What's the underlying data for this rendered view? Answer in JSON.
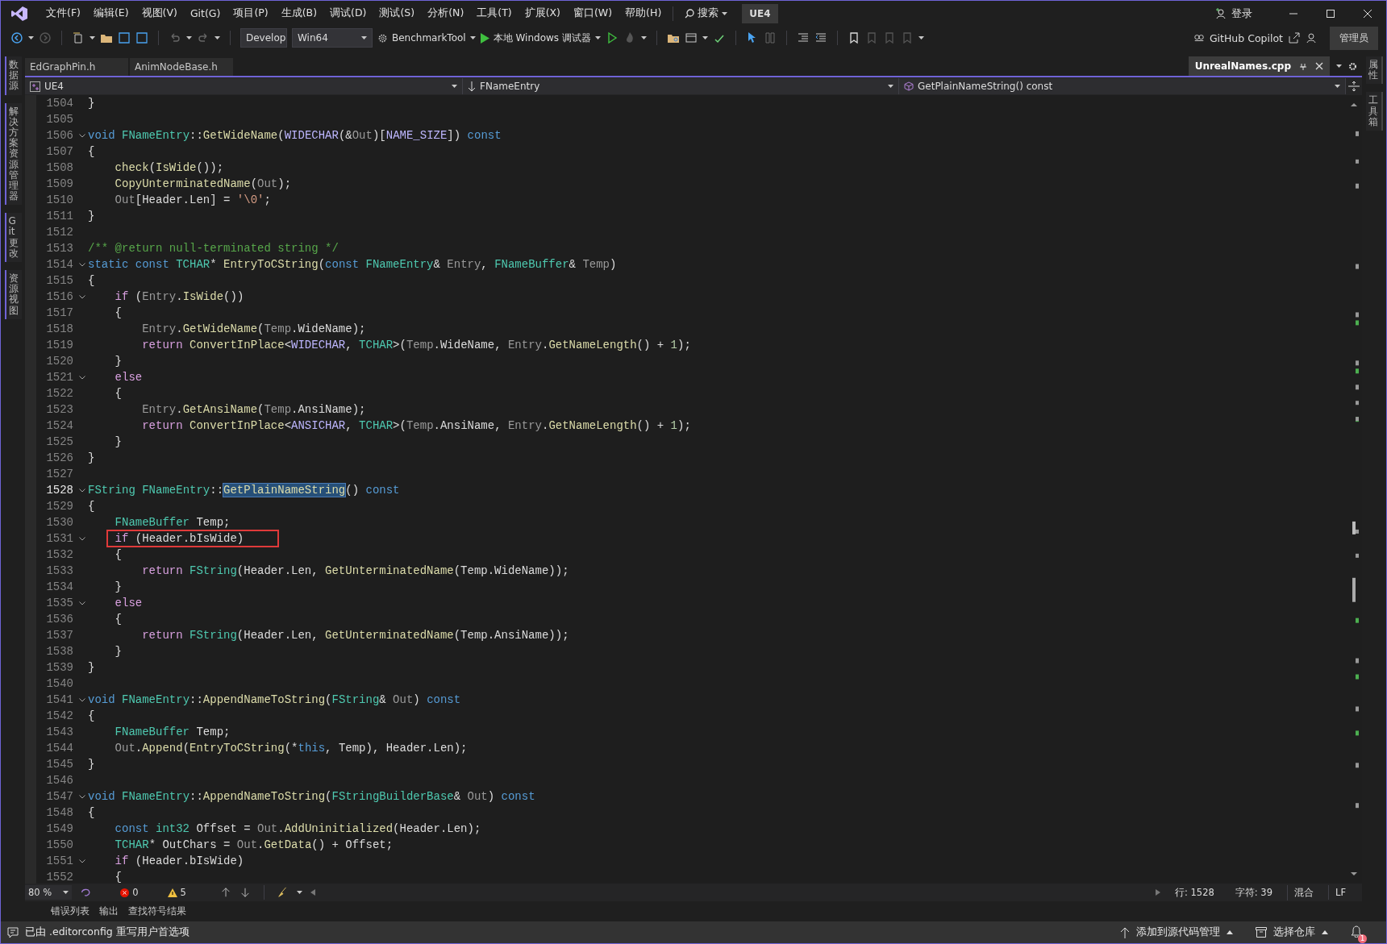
{
  "menu": [
    "文件(F)",
    "编辑(E)",
    "视图(V)",
    "Git(G)",
    "项目(P)",
    "生成(B)",
    "调试(D)",
    "测试(S)",
    "分析(N)",
    "工具(T)",
    "扩展(X)",
    "窗口(W)",
    "帮助(H)"
  ],
  "search": "搜索",
  "solution": "UE4",
  "login": "登录",
  "toolbar": {
    "configuration": "Develop",
    "platform": "Win64",
    "startup": "BenchmarkTool",
    "debugger": "本地 Windows 调试器",
    "copilot": "GitHub Copilot",
    "admin": "管理员"
  },
  "left_tabs": [
    "数据源",
    "解决方案资源管理器",
    "Git 更改",
    "资源视图"
  ],
  "right_tabs": [
    "属性",
    "工具箱"
  ],
  "doc_tabs": [
    {
      "label": "EdGraphPin.h",
      "selected": false
    },
    {
      "label": "AnimNodeBase.h",
      "selected": false
    },
    {
      "label": "UnrealNames.cpp",
      "selected": true
    }
  ],
  "nav": {
    "project": "UE4",
    "scope": "FNameEntry",
    "member": "GetPlainNameString() const"
  },
  "lines": [
    {
      "number": "1504",
      "fold": false,
      "current": false,
      "boxed": false,
      "tokens": [
        {
          "kind": "plain",
          "text": "}"
        }
      ]
    },
    {
      "number": "1505",
      "fold": false,
      "current": false,
      "boxed": false
    },
    {
      "number": "1506",
      "fold": true,
      "current": false,
      "boxed": false,
      "tokens": [
        {
          "kind": "keyword",
          "text": "void "
        },
        {
          "kind": "type",
          "text": "FNameEntry"
        },
        {
          "kind": "plain",
          "text": "::"
        },
        {
          "kind": "function",
          "text": "GetWideName"
        },
        {
          "kind": "plain",
          "text": "("
        },
        {
          "kind": "macro",
          "text": "WIDECHAR"
        },
        {
          "kind": "plain",
          "text": "(&"
        },
        {
          "kind": "param",
          "text": "Out"
        },
        {
          "kind": "plain",
          "text": ")["
        },
        {
          "kind": "macro",
          "text": "NAME_SIZE"
        },
        {
          "kind": "plain",
          "text": "]) "
        },
        {
          "kind": "keyword",
          "text": "const"
        }
      ]
    },
    {
      "number": "1507",
      "fold": false,
      "current": false,
      "boxed": false,
      "tokens": [
        {
          "kind": "plain",
          "text": "{"
        }
      ]
    },
    {
      "number": "1508",
      "fold": false,
      "current": false,
      "boxed": false,
      "tokens": [
        {
          "kind": "function",
          "text": "    check"
        },
        {
          "kind": "plain",
          "text": "("
        },
        {
          "kind": "function",
          "text": "IsWide"
        },
        {
          "kind": "plain",
          "text": "());"
        }
      ]
    },
    {
      "number": "1509",
      "fold": false,
      "current": false,
      "boxed": false,
      "tokens": [
        {
          "kind": "function",
          "text": "    CopyUnterminatedName"
        },
        {
          "kind": "plain",
          "text": "("
        },
        {
          "kind": "param",
          "text": "Out"
        },
        {
          "kind": "plain",
          "text": ");"
        }
      ]
    },
    {
      "number": "1510",
      "fold": false,
      "current": false,
      "boxed": false,
      "tokens": [
        {
          "kind": "param",
          "text": "    Out"
        },
        {
          "kind": "plain",
          "text": "[Header.Len] = "
        },
        {
          "kind": "string",
          "text": "'\\0'"
        },
        {
          "kind": "plain",
          "text": ";"
        }
      ]
    },
    {
      "number": "1511",
      "fold": false,
      "current": false,
      "boxed": false,
      "tokens": [
        {
          "kind": "plain",
          "text": "}"
        }
      ]
    },
    {
      "number": "1512",
      "fold": false,
      "current": false,
      "boxed": false
    },
    {
      "number": "1513",
      "fold": false,
      "current": false,
      "boxed": false,
      "tokens": [
        {
          "kind": "comment",
          "text": "/** @return null-terminated string */"
        }
      ]
    },
    {
      "number": "1514",
      "fold": true,
      "current": false,
      "boxed": false,
      "tokens": [
        {
          "kind": "keyword",
          "text": "static const "
        },
        {
          "kind": "type",
          "text": "TCHAR"
        },
        {
          "kind": "plain",
          "text": "* "
        },
        {
          "kind": "function",
          "text": "EntryToCString"
        },
        {
          "kind": "plain",
          "text": "("
        },
        {
          "kind": "keyword",
          "text": "const "
        },
        {
          "kind": "type",
          "text": "FNameEntry"
        },
        {
          "kind": "plain",
          "text": "& "
        },
        {
          "kind": "param",
          "text": "Entry"
        },
        {
          "kind": "plain",
          "text": ", "
        },
        {
          "kind": "type",
          "text": "FNameBuffer"
        },
        {
          "kind": "plain",
          "text": "& "
        },
        {
          "kind": "param",
          "text": "Temp"
        },
        {
          "kind": "plain",
          "text": ")"
        }
      ]
    },
    {
      "number": "1515",
      "fold": false,
      "current": false,
      "boxed": false,
      "tokens": [
        {
          "kind": "plain",
          "text": "{"
        }
      ]
    },
    {
      "number": "1516",
      "fold": true,
      "current": false,
      "boxed": false,
      "tokens": [
        {
          "kind": "control",
          "text": "    if"
        },
        {
          "kind": "plain",
          "text": " ("
        },
        {
          "kind": "param",
          "text": "Entry"
        },
        {
          "kind": "plain",
          "text": "."
        },
        {
          "kind": "function",
          "text": "IsWide"
        },
        {
          "kind": "plain",
          "text": "())"
        }
      ]
    },
    {
      "number": "1517",
      "fold": false,
      "current": false,
      "boxed": false,
      "tokens": [
        {
          "kind": "plain",
          "text": "    {"
        }
      ]
    },
    {
      "number": "1518",
      "fold": false,
      "current": false,
      "boxed": false,
      "tokens": [
        {
          "kind": "param",
          "text": "        Entry"
        },
        {
          "kind": "plain",
          "text": "."
        },
        {
          "kind": "function",
          "text": "GetWideName"
        },
        {
          "kind": "plain",
          "text": "("
        },
        {
          "kind": "param",
          "text": "Temp"
        },
        {
          "kind": "plain",
          "text": ".WideName);"
        }
      ]
    },
    {
      "number": "1519",
      "fold": false,
      "current": false,
      "boxed": false,
      "tokens": [
        {
          "kind": "control",
          "text": "        return "
        },
        {
          "kind": "function",
          "text": "ConvertInPlace"
        },
        {
          "kind": "plain",
          "text": "<"
        },
        {
          "kind": "macro",
          "text": "WIDECHAR"
        },
        {
          "kind": "plain",
          "text": ", "
        },
        {
          "kind": "type",
          "text": "TCHAR"
        },
        {
          "kind": "plain",
          "text": ">("
        },
        {
          "kind": "param",
          "text": "Temp"
        },
        {
          "kind": "plain",
          "text": ".WideName, "
        },
        {
          "kind": "param",
          "text": "Entry"
        },
        {
          "kind": "plain",
          "text": "."
        },
        {
          "kind": "function",
          "text": "GetNameLength"
        },
        {
          "kind": "plain",
          "text": "() + "
        },
        {
          "kind": "number",
          "text": "1"
        },
        {
          "kind": "plain",
          "text": ");"
        }
      ]
    },
    {
      "number": "1520",
      "fold": false,
      "current": false,
      "boxed": false,
      "tokens": [
        {
          "kind": "plain",
          "text": "    }"
        }
      ]
    },
    {
      "number": "1521",
      "fold": true,
      "current": false,
      "boxed": false,
      "tokens": [
        {
          "kind": "control",
          "text": "    else"
        }
      ]
    },
    {
      "number": "1522",
      "fold": false,
      "current": false,
      "boxed": false,
      "tokens": [
        {
          "kind": "plain",
          "text": "    {"
        }
      ]
    },
    {
      "number": "1523",
      "fold": false,
      "current": false,
      "boxed": false,
      "tokens": [
        {
          "kind": "param",
          "text": "        Entry"
        },
        {
          "kind": "plain",
          "text": "."
        },
        {
          "kind": "function",
          "text": "GetAnsiName"
        },
        {
          "kind": "plain",
          "text": "("
        },
        {
          "kind": "param",
          "text": "Temp"
        },
        {
          "kind": "plain",
          "text": ".AnsiName);"
        }
      ]
    },
    {
      "number": "1524",
      "fold": false,
      "current": false,
      "boxed": false,
      "tokens": [
        {
          "kind": "control",
          "text": "        return "
        },
        {
          "kind": "function",
          "text": "ConvertInPlace"
        },
        {
          "kind": "plain",
          "text": "<"
        },
        {
          "kind": "macro",
          "text": "ANSICHAR"
        },
        {
          "kind": "plain",
          "text": ", "
        },
        {
          "kind": "type",
          "text": "TCHAR"
        },
        {
          "kind": "plain",
          "text": ">("
        },
        {
          "kind": "param",
          "text": "Temp"
        },
        {
          "kind": "plain",
          "text": ".AnsiName, "
        },
        {
          "kind": "param",
          "text": "Entry"
        },
        {
          "kind": "plain",
          "text": "."
        },
        {
          "kind": "function",
          "text": "GetNameLength"
        },
        {
          "kind": "plain",
          "text": "() + "
        },
        {
          "kind": "number",
          "text": "1"
        },
        {
          "kind": "plain",
          "text": ");"
        }
      ]
    },
    {
      "number": "1525",
      "fold": false,
      "current": false,
      "boxed": false,
      "tokens": [
        {
          "kind": "plain",
          "text": "    }"
        }
      ]
    },
    {
      "number": "1526",
      "fold": false,
      "current": false,
      "boxed": false,
      "tokens": [
        {
          "kind": "plain",
          "text": "}"
        }
      ]
    },
    {
      "number": "1527",
      "fold": false,
      "current": false,
      "boxed": false
    },
    {
      "number": "1528",
      "fold": true,
      "current": true,
      "boxed": false,
      "tokens": [
        {
          "kind": "type",
          "text": "FString "
        },
        {
          "kind": "type",
          "text": "FNameEntry"
        },
        {
          "kind": "plain",
          "text": "::"
        },
        {
          "kind": "selected",
          "text": "GetPlainNameString"
        },
        {
          "kind": "plain",
          "text": "() "
        },
        {
          "kind": "keyword",
          "text": "const"
        }
      ]
    },
    {
      "number": "1529",
      "fold": false,
      "current": false,
      "boxed": false,
      "tokens": [
        {
          "kind": "plain",
          "text": "{"
        }
      ]
    },
    {
      "number": "1530",
      "fold": false,
      "current": false,
      "boxed": false,
      "tokens": [
        {
          "kind": "type",
          "text": "    FNameBuffer"
        },
        {
          "kind": "plain",
          "text": " Temp;"
        }
      ]
    },
    {
      "number": "1531",
      "fold": true,
      "current": false,
      "boxed": true,
      "tokens": [
        {
          "kind": "control",
          "text": "    if"
        },
        {
          "kind": "plain",
          "text": " (Header.bIsWide)"
        }
      ]
    },
    {
      "number": "1532",
      "fold": false,
      "current": false,
      "boxed": false,
      "tokens": [
        {
          "kind": "plain",
          "text": "    {"
        }
      ]
    },
    {
      "number": "1533",
      "fold": false,
      "current": false,
      "boxed": false,
      "tokens": [
        {
          "kind": "control",
          "text": "        return "
        },
        {
          "kind": "type",
          "text": "FString"
        },
        {
          "kind": "plain",
          "text": "(Header.Len, "
        },
        {
          "kind": "function",
          "text": "GetUnterminatedName"
        },
        {
          "kind": "plain",
          "text": "(Temp.WideName));"
        }
      ]
    },
    {
      "number": "1534",
      "fold": false,
      "current": false,
      "boxed": false,
      "tokens": [
        {
          "kind": "plain",
          "text": "    }"
        }
      ]
    },
    {
      "number": "1535",
      "fold": true,
      "current": false,
      "boxed": false,
      "tokens": [
        {
          "kind": "control",
          "text": "    else"
        }
      ]
    },
    {
      "number": "1536",
      "fold": false,
      "current": false,
      "boxed": false,
      "tokens": [
        {
          "kind": "plain",
          "text": "    {"
        }
      ]
    },
    {
      "number": "1537",
      "fold": false,
      "current": false,
      "boxed": false,
      "tokens": [
        {
          "kind": "control",
          "text": "        return "
        },
        {
          "kind": "type",
          "text": "FString"
        },
        {
          "kind": "plain",
          "text": "(Header.Len, "
        },
        {
          "kind": "function",
          "text": "GetUnterminatedName"
        },
        {
          "kind": "plain",
          "text": "(Temp.AnsiName));"
        }
      ]
    },
    {
      "number": "1538",
      "fold": false,
      "current": false,
      "boxed": false,
      "tokens": [
        {
          "kind": "plain",
          "text": "    }"
        }
      ]
    },
    {
      "number": "1539",
      "fold": false,
      "current": false,
      "boxed": false,
      "tokens": [
        {
          "kind": "plain",
          "text": "}"
        }
      ]
    },
    {
      "number": "1540",
      "fold": false,
      "current": false,
      "boxed": false
    },
    {
      "number": "1541",
      "fold": true,
      "current": false,
      "boxed": false,
      "tokens": [
        {
          "kind": "keyword",
          "text": "void "
        },
        {
          "kind": "type",
          "text": "FNameEntry"
        },
        {
          "kind": "plain",
          "text": "::"
        },
        {
          "kind": "function",
          "text": "AppendNameToString"
        },
        {
          "kind": "plain",
          "text": "("
        },
        {
          "kind": "type",
          "text": "FString"
        },
        {
          "kind": "plain",
          "text": "& "
        },
        {
          "kind": "param",
          "text": "Out"
        },
        {
          "kind": "plain",
          "text": ") "
        },
        {
          "kind": "keyword",
          "text": "const"
        }
      ]
    },
    {
      "number": "1542",
      "fold": false,
      "current": false,
      "boxed": false,
      "tokens": [
        {
          "kind": "plain",
          "text": "{"
        }
      ]
    },
    {
      "number": "1543",
      "fold": false,
      "current": false,
      "boxed": false,
      "tokens": [
        {
          "kind": "type",
          "text": "    FNameBuffer"
        },
        {
          "kind": "plain",
          "text": " Temp;"
        }
      ]
    },
    {
      "number": "1544",
      "fold": false,
      "current": false,
      "boxed": false,
      "tokens": [
        {
          "kind": "param",
          "text": "    Out"
        },
        {
          "kind": "plain",
          "text": "."
        },
        {
          "kind": "function",
          "text": "Append"
        },
        {
          "kind": "plain",
          "text": "("
        },
        {
          "kind": "function",
          "text": "EntryToCString"
        },
        {
          "kind": "plain",
          "text": "(*"
        },
        {
          "kind": "keyword",
          "text": "this"
        },
        {
          "kind": "plain",
          "text": ", Temp), Header.Len);"
        }
      ]
    },
    {
      "number": "1545",
      "fold": false,
      "current": false,
      "boxed": false,
      "tokens": [
        {
          "kind": "plain",
          "text": "}"
        }
      ]
    },
    {
      "number": "1546",
      "fold": false,
      "current": false,
      "boxed": false
    },
    {
      "number": "1547",
      "fold": true,
      "current": false,
      "boxed": false,
      "tokens": [
        {
          "kind": "keyword",
          "text": "void "
        },
        {
          "kind": "type",
          "text": "FNameEntry"
        },
        {
          "kind": "plain",
          "text": "::"
        },
        {
          "kind": "function",
          "text": "AppendNameToString"
        },
        {
          "kind": "plain",
          "text": "("
        },
        {
          "kind": "type",
          "text": "FStringBuilderBase"
        },
        {
          "kind": "plain",
          "text": "& "
        },
        {
          "kind": "param",
          "text": "Out"
        },
        {
          "kind": "plain",
          "text": ") "
        },
        {
          "kind": "keyword",
          "text": "const"
        }
      ]
    },
    {
      "number": "1548",
      "fold": false,
      "current": false,
      "boxed": false,
      "tokens": [
        {
          "kind": "plain",
          "text": "{"
        }
      ]
    },
    {
      "number": "1549",
      "fold": false,
      "current": false,
      "boxed": false,
      "tokens": [
        {
          "kind": "keyword",
          "text": "    const "
        },
        {
          "kind": "type",
          "text": "int32"
        },
        {
          "kind": "plain",
          "text": " Offset = "
        },
        {
          "kind": "param",
          "text": "Out"
        },
        {
          "kind": "plain",
          "text": "."
        },
        {
          "kind": "function",
          "text": "AddUninitialized"
        },
        {
          "kind": "plain",
          "text": "(Header.Len);"
        }
      ]
    },
    {
      "number": "1550",
      "fold": false,
      "current": false,
      "boxed": false,
      "tokens": [
        {
          "kind": "type",
          "text": "    TCHAR"
        },
        {
          "kind": "plain",
          "text": "* OutChars = "
        },
        {
          "kind": "param",
          "text": "Out"
        },
        {
          "kind": "plain",
          "text": "."
        },
        {
          "kind": "function",
          "text": "GetData"
        },
        {
          "kind": "plain",
          "text": "() + Offset;"
        }
      ]
    },
    {
      "number": "1551",
      "fold": true,
      "current": false,
      "boxed": false,
      "tokens": [
        {
          "kind": "control",
          "text": "    if"
        },
        {
          "kind": "plain",
          "text": " (Header.bIsWide)"
        }
      ]
    },
    {
      "number": "1552",
      "fold": false,
      "current": false,
      "boxed": false,
      "tokens": [
        {
          "kind": "plain",
          "text": "    {"
        }
      ]
    }
  ],
  "editor_status": {
    "zoom": "80 %",
    "errors": "0",
    "warnings": "5",
    "line": "行: 1528",
    "column": "字符: 39",
    "indent": "混合",
    "eol": "LF"
  },
  "panel_tabs": [
    "错误列表",
    "输出",
    "查找符号结果"
  ],
  "status_bar": {
    "message": "已由 .editorconfig 重写用户首选项",
    "source_control": "添加到源代码管理",
    "repository": "选择仓库",
    "notifications": "1"
  }
}
